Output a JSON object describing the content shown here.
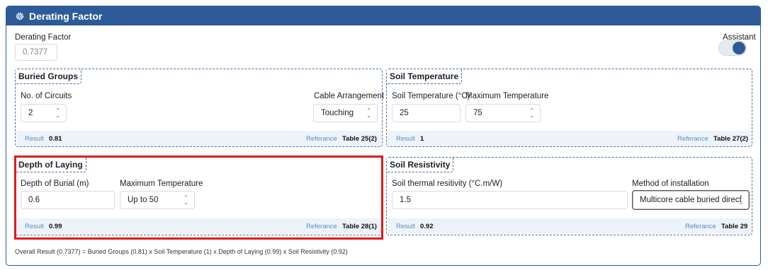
{
  "header": {
    "title": "Derating Factor",
    "icon": "gear-icon"
  },
  "derating": {
    "label": "Derating Factor",
    "value": "0.7377"
  },
  "assistant": {
    "label": "Assistant",
    "enabled": true
  },
  "common": {
    "result_label": "Result",
    "reference_label": "Referance"
  },
  "buried_groups": {
    "title": "Buried Groups",
    "circuits_label": "No. of Circuits",
    "circuits_value": "2",
    "arrangement_label": "Cable Arrangement",
    "arrangement_value": "Touching",
    "result": "0.81",
    "reference": "Table 25(2)"
  },
  "soil_temperature": {
    "title": "Soil Temperature",
    "temp_label": "Soil Temperature (°C)",
    "temp_value": "25",
    "max_label": "Maximum Temperature",
    "max_value": "75",
    "result": "1",
    "reference": "Table 27(2)"
  },
  "depth_of_laying": {
    "title": "Depth of Laying",
    "depth_label": "Depth of Burial (m)",
    "depth_value": "0.6",
    "max_label": "Maximum Temperature",
    "max_value": "Up to 50",
    "result": "0.99",
    "reference": "Table 28(1)"
  },
  "soil_resistivity": {
    "title": "Soil Resistivity",
    "resistivity_label": "Soil thermal resitivity (°C.m/W)",
    "resistivity_value": "1.5",
    "method_label": "Method of installation",
    "method_value": "Multicore cable buried direct",
    "result": "0.92",
    "reference": "Table 29"
  },
  "footer": {
    "note": "Overall Result (0.7377) = Buried Groups (0.81) x Soil Temperature (1) x Depth of Laying (0.99) x Soil Resistivity (0.92)"
  },
  "colors": {
    "header": "#2d5b98",
    "highlight": "#e01b1b",
    "result_bar": "#eef3f9",
    "result_label": "#5a8ec6"
  }
}
